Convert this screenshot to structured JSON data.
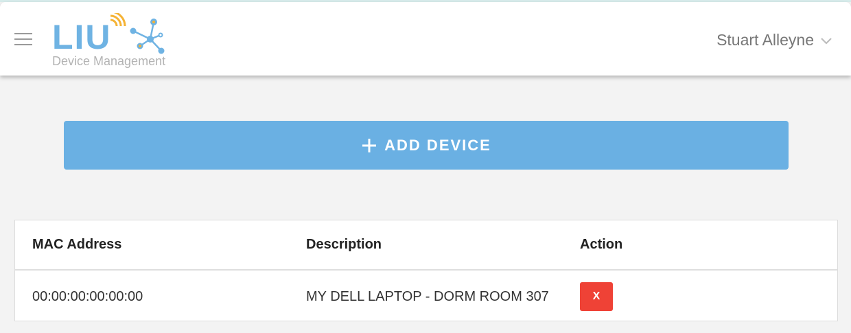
{
  "header": {
    "logo_text": "LIU",
    "logo_subtitle": "Device Management",
    "user_name": "Stuart Alleyne"
  },
  "colors": {
    "accent": "#6ab0e3",
    "logo_blue": "#6fb3e3",
    "logo_orange": "#f5b335",
    "danger": "#ef4236",
    "background": "#f3f3f3"
  },
  "icons": {
    "menu": "hamburger-icon",
    "user_dropdown": "chevron-down-icon",
    "add": "plus-icon"
  },
  "add_device": {
    "label": "ADD DEVICE"
  },
  "devices_table": {
    "columns": [
      "MAC Address",
      "Description",
      "Action"
    ],
    "rows": [
      {
        "mac": "00:00:00:00:00:00",
        "description": "MY DELL LAPTOP - DORM ROOM 307",
        "action_label": "X"
      }
    ]
  }
}
